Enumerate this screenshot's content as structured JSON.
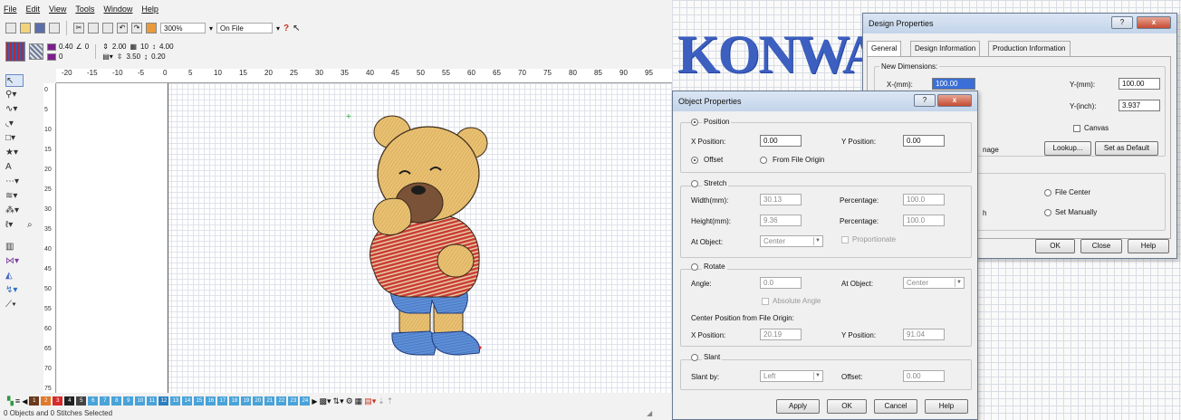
{
  "menu": [
    "File",
    "Edit",
    "View",
    "Tools",
    "Window",
    "Help"
  ],
  "toolbar1": {
    "zoom": "300%",
    "mode": "On File",
    "help_glyph": "?"
  },
  "toolbar2": {
    "line_width": "0.40",
    "angle": "0",
    "color_index": "0",
    "density": "2.00",
    "count": "10",
    "spacing": "4.00",
    "pull": "3.50",
    "comp": "0.20"
  },
  "ruler_top": [
    "-20",
    "-15",
    "-10",
    "-5",
    "0",
    "5",
    "10",
    "15",
    "20",
    "25",
    "30",
    "35",
    "40",
    "45",
    "50",
    "55",
    "60",
    "65",
    "70",
    "75",
    "80",
    "85",
    "90",
    "95"
  ],
  "ruler_left": [
    "0",
    "5",
    "10",
    "15",
    "20",
    "25",
    "30",
    "35",
    "40",
    "45",
    "50",
    "55",
    "60",
    "65",
    "70",
    "75"
  ],
  "palette": [
    "1",
    "2",
    "3",
    "4",
    "5",
    "6",
    "7",
    "8",
    "9",
    "10",
    "11",
    "12",
    "13",
    "14",
    "15",
    "16",
    "17",
    "18",
    "19",
    "20",
    "21",
    "22",
    "23",
    "24"
  ],
  "palette_colors": [
    "#6b3a1c",
    "#e07a2a",
    "#d72a2a",
    "#222222",
    "#444444",
    "#4aa3d8",
    "#4aa3d8",
    "#4aa3d8",
    "#4aa3d8",
    "#4aa3d8",
    "#4aa3d8",
    "#2b7fc0",
    "#4aa3d8",
    "#4aa3d8",
    "#4aa3d8",
    "#4aa3d8",
    "#4aa3d8",
    "#4aa3d8",
    "#4aa3d8",
    "#4aa3d8",
    "#4aa3d8",
    "#4aa3d8",
    "#4aa3d8",
    "#4aa3d8"
  ],
  "status": "0 Objects and 0 Stitches Selected",
  "logo_text": "KONWA",
  "design_dialog": {
    "title": "Design Properties",
    "tabs": [
      "General",
      "Design Information",
      "Production Information"
    ],
    "group_label": "New Dimensions:",
    "x_mm_label": "X-(mm):",
    "x_mm_value": "100.00",
    "y_mm_label": "Y-(mm):",
    "y_mm_value": "100.00",
    "y_inch_label": "Y-(inch):",
    "y_inch_value": "3.937",
    "canvas_label": "Canvas",
    "image_fragment": "nage",
    "lookup_button": "Lookup...",
    "default_button": "Set as Default",
    "h_fragment": "h",
    "file_center_label": "File Center",
    "set_manually_label": "Set Manually",
    "ok_button": "OK",
    "close_button": "Close",
    "help_button": "Help",
    "help_glyph": "?",
    "close_glyph": "x"
  },
  "object_dialog": {
    "title": "Object Properties",
    "help_glyph": "?",
    "close_glyph": "x",
    "position": {
      "label": "Position",
      "x_label": "X Position:",
      "x_value": "0.00",
      "y_label": "Y Position:",
      "y_value": "0.00",
      "offset_label": "Offset",
      "from_origin_label": "From File Origin"
    },
    "stretch": {
      "label": "Stretch",
      "width_label": "Width(mm):",
      "width_value": "30.13",
      "height_label": "Height(mm):",
      "height_value": "9.36",
      "pct_label": "Percentage:",
      "pct_w_value": "100.0",
      "pct_h_value": "100.0",
      "at_object_label": "At Object:",
      "at_object_value": "Center",
      "proportionate_label": "Proportionate"
    },
    "rotate": {
      "label": "Rotate",
      "angle_label": "Angle:",
      "angle_value": "0.0",
      "at_object_label": "At Object:",
      "at_object_value": "Center",
      "absolute_label": "Absolute Angle",
      "center_label": "Center Position from File Origin:",
      "x_label": "X Position:",
      "x_value": "20.19",
      "y_label": "Y Position:",
      "y_value": "91.04"
    },
    "slant": {
      "label": "Slant",
      "by_label": "Slant by:",
      "by_value": "Left",
      "offset_label": "Offset:",
      "offset_value": "0.00"
    },
    "apply_button": "Apply",
    "ok_button": "OK",
    "cancel_button": "Cancel",
    "help_button": "Help"
  },
  "colors": {
    "accent": "#3c5fc0",
    "title_bar": "#c2d4ea",
    "close_red": "#c64a32"
  }
}
